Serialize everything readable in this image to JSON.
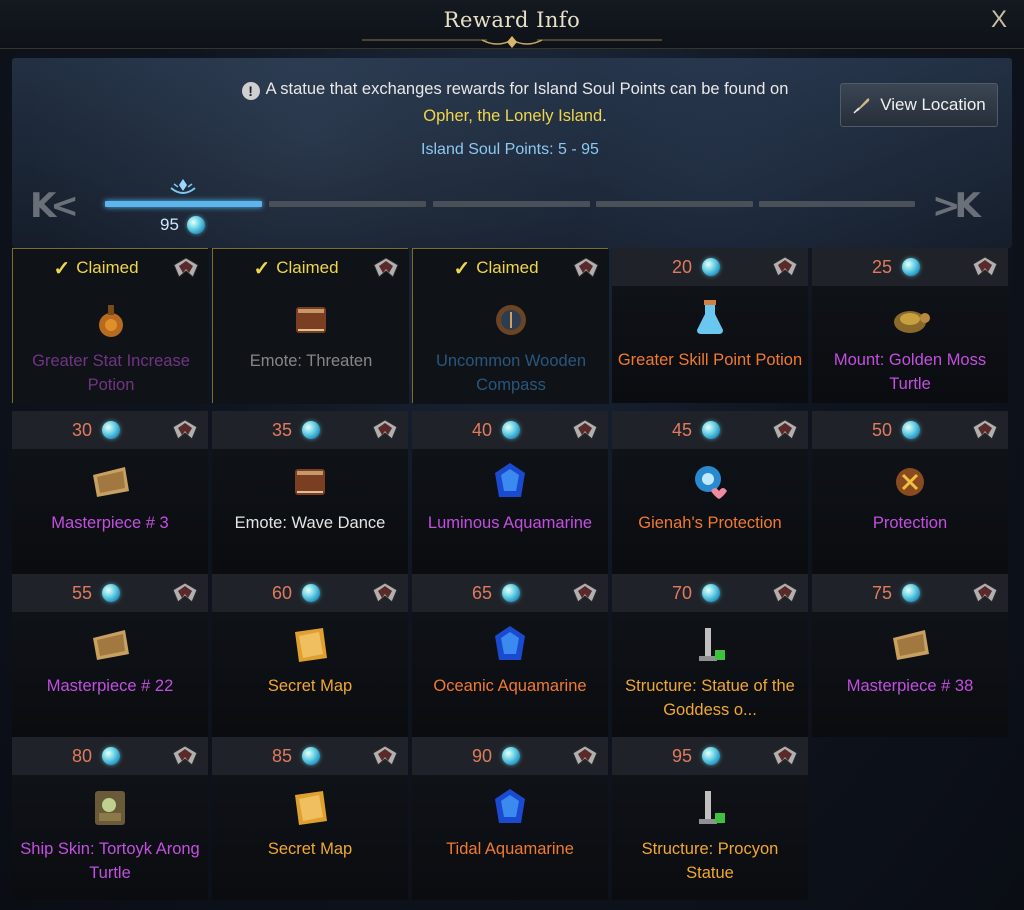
{
  "window": {
    "title": "Reward Info",
    "close_label": "X"
  },
  "notice": {
    "text": "A statue that exchanges rewards for Island Soul Points can be found on",
    "location": "Opher, the Lonely Island",
    "location_suffix": ".",
    "points_range": "Island Soul Points: 5 - 95",
    "view_location_label": "View Location",
    "view_location_icon": "quill-icon",
    "info_icon": "!"
  },
  "progress": {
    "current": "95",
    "nav_prev_label": "K<",
    "nav_next_label": ">K",
    "segments_total": 5,
    "segments_filled": 1,
    "accent_color": "#5ab6ec"
  },
  "rewards": [
    {
      "status": "Claimed",
      "name": "Greater Stat Increase Potion",
      "icon": "potion-icon"
    },
    {
      "status": "Claimed",
      "name": "Emote: Threaten",
      "icon": "book-icon"
    },
    {
      "status": "Claimed",
      "name": "Uncommon Wooden Compass",
      "icon": "compass-icon"
    },
    {
      "points": "20",
      "name": "Greater Skill Point Potion",
      "icon": "flask-icon"
    },
    {
      "points": "25",
      "name": "Mount: Golden Moss Turtle",
      "icon": "turtle-icon"
    },
    {
      "points": "30",
      "name": "Masterpiece # 3",
      "icon": "painting-icon"
    },
    {
      "points": "35",
      "name": "Emote: Wave Dance",
      "icon": "book-icon"
    },
    {
      "points": "40",
      "name": "Luminous Aquamarine",
      "icon": "gem-icon"
    },
    {
      "points": "45",
      "name": "Gienah's Protection",
      "icon": "orb-heart-icon"
    },
    {
      "points": "50",
      "name": "Protection",
      "icon": "rune-icon"
    },
    {
      "points": "55",
      "name": "Masterpiece # 22",
      "icon": "painting-icon"
    },
    {
      "points": "60",
      "name": "Secret Map",
      "icon": "map-icon"
    },
    {
      "points": "65",
      "name": "Oceanic Aquamarine",
      "icon": "gem-icon"
    },
    {
      "points": "70",
      "name": "Structure: Statue of the Goddess o...",
      "icon": "statue-icon"
    },
    {
      "points": "75",
      "name": "Masterpiece # 38",
      "icon": "painting-icon"
    },
    {
      "points": "80",
      "name": "Ship Skin: Tortoyk Arong Turtle",
      "icon": "ship-skin-icon"
    },
    {
      "points": "85",
      "name": "Secret Map",
      "icon": "map-icon"
    },
    {
      "points": "90",
      "name": "Tidal Aquamarine",
      "icon": "gem-icon"
    },
    {
      "points": "95",
      "name": "Structure: Procyon Statue",
      "icon": "statue-icon"
    }
  ]
}
